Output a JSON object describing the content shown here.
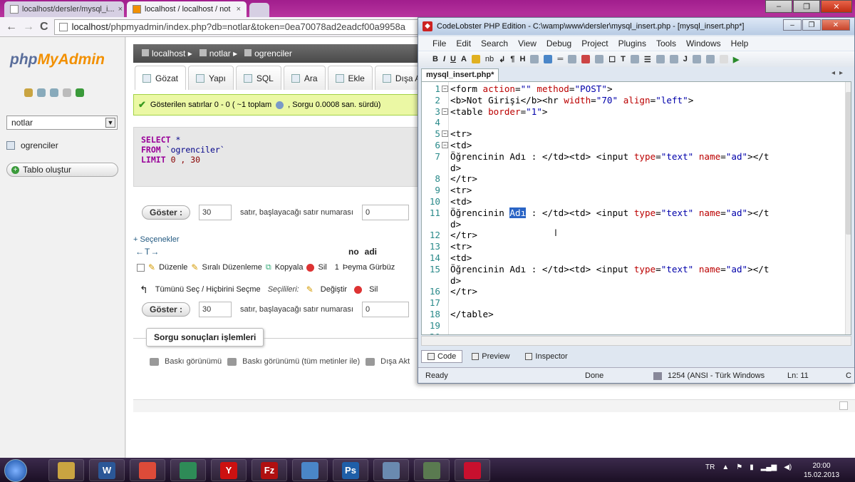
{
  "browser": {
    "tabs": [
      {
        "label": "localhost/dersler/mysql_i..."
      },
      {
        "label": "localhost / localhost / not"
      }
    ],
    "tab_close": "×",
    "url_host": "localhost",
    "url_rest": "/phpmyadmin/index.php?db=notlar&token=0ea70078ad2eadcf00a9958a",
    "back": "←",
    "forward": "→",
    "reload": "C"
  },
  "window_controls": {
    "min": "–",
    "max": "❐",
    "close": "✕"
  },
  "pma": {
    "logo_php": "php",
    "logo_myadmin": "MyAdmin",
    "db_select": "notlar",
    "table_item": "ogrenciler",
    "create_table": "Tablo oluştur",
    "breadcrumb": [
      "localhost",
      "notlar",
      "ogrenciler"
    ],
    "tabs": [
      "Gözat",
      "Yapı",
      "SQL",
      "Ara",
      "Ekle",
      "Dışa A"
    ],
    "success": "Gösterilen satırlar 0 - 0 ( ~1 toplam",
    "success_tail": ", Sorgu 0.0008 san. sürdü)",
    "sql": {
      "select_kw": "SELECT",
      "select_val": "*",
      "from_kw": "FROM",
      "from_val": "`ogrenciler`",
      "limit_kw": "LIMIT",
      "limit_val": "0 , 30"
    },
    "show_button": "Göster :",
    "rows_value": "30",
    "rows_label": "satır, başlayacağı satır numarası",
    "start_value": "0",
    "options_link": "+ Seçenekler",
    "resize_arrows": "←T→",
    "columns": [
      "no",
      "adi"
    ],
    "row": {
      "edit": "Düzenle",
      "inline_edit": "Sıralı Düzenleme",
      "copy": "Kopyala",
      "delete": "Sil",
      "no": "1",
      "adi": "Þeyma Gürbüz"
    },
    "check_all": "Tümünü Seç / Hiçbirini Seçme",
    "selected": "Seçilileri:",
    "change": "Değiştir",
    "delete_sel": "Sil",
    "ops_legend": "Sorgu sonuçları işlemleri",
    "ops": [
      "Baskı görünümü",
      "Baskı görünümü (tüm metinler ile)",
      "Dışa Akt"
    ]
  },
  "codelobster": {
    "title": "CodeLobster PHP Edition - C:\\wamp\\www\\dersler\\mysql_insert.php - [mysql_insert.php*]",
    "menu": [
      "File",
      "Edit",
      "Search",
      "View",
      "Debug",
      "Project",
      "Plugins",
      "Tools",
      "Windows",
      "Help"
    ],
    "file_tab": "mysql_insert.php*",
    "mode_tabs": [
      "Code",
      "Preview",
      "Inspector"
    ],
    "status": {
      "state": "Ready",
      "done": "Done",
      "encoding": "1254 (ANSI - Türk Windows",
      "line": "Ln: 11",
      "col": "C"
    }
  },
  "code": [
    {
      "n": "1",
      "parts": [
        [
          "tg",
          "<form "
        ],
        [
          "at",
          "action"
        ],
        [
          "tg",
          "="
        ],
        [
          "av",
          "\"\""
        ],
        [
          "tg",
          " "
        ],
        [
          "at",
          "method"
        ],
        [
          "tg",
          "="
        ],
        [
          "av",
          "\"POST\""
        ],
        [
          "tg",
          ">"
        ]
      ]
    },
    {
      "n": "2",
      "parts": [
        [
          "tg",
          "<b>Not Girişi</b><hr "
        ],
        [
          "at",
          "width"
        ],
        [
          "tg",
          "="
        ],
        [
          "av",
          "\"70\""
        ],
        [
          "tg",
          " "
        ],
        [
          "at",
          "align"
        ],
        [
          "tg",
          "="
        ],
        [
          "av",
          "\"left\""
        ],
        [
          "tg",
          ">"
        ]
      ]
    },
    {
      "n": "3",
      "parts": [
        [
          "tg",
          "<table "
        ],
        [
          "at",
          "border"
        ],
        [
          "tg",
          "="
        ],
        [
          "av",
          "\"1\""
        ],
        [
          "tg",
          ">"
        ]
      ]
    },
    {
      "n": "4",
      "parts": []
    },
    {
      "n": "5",
      "parts": [
        [
          "tg",
          "<tr>"
        ]
      ]
    },
    {
      "n": "6",
      "parts": [
        [
          "tg",
          "<td>"
        ]
      ]
    },
    {
      "n": "7",
      "parts": [
        [
          "cw",
          "Öğrencinin Adı : "
        ],
        [
          "tg",
          "</td><td> <input "
        ],
        [
          "at",
          "type"
        ],
        [
          "tg",
          "="
        ],
        [
          "av",
          "\"text\""
        ],
        [
          "tg",
          " "
        ],
        [
          "at",
          "name"
        ],
        [
          "tg",
          "="
        ],
        [
          "av",
          "\"ad\""
        ],
        [
          "tg",
          "></t"
        ]
      ]
    },
    {
      "n": "",
      "parts": [
        [
          "tg",
          "d>"
        ]
      ]
    },
    {
      "n": "8",
      "parts": [
        [
          "tg",
          "</tr>"
        ]
      ]
    },
    {
      "n": "9",
      "parts": [
        [
          "tg",
          "<tr>"
        ]
      ]
    },
    {
      "n": "10",
      "parts": [
        [
          "tg",
          "<td>"
        ]
      ]
    },
    {
      "n": "11",
      "parts": [
        [
          "cw",
          "Öğrencinin "
        ],
        [
          "sel",
          "Adı"
        ],
        [
          "cw",
          " : "
        ],
        [
          "tg",
          "</td><td> <input "
        ],
        [
          "at",
          "type"
        ],
        [
          "tg",
          "="
        ],
        [
          "av",
          "\"text\""
        ],
        [
          "tg",
          " "
        ],
        [
          "at",
          "name"
        ],
        [
          "tg",
          "="
        ],
        [
          "av",
          "\"ad\""
        ],
        [
          "tg",
          "></t"
        ]
      ]
    },
    {
      "n": "",
      "parts": [
        [
          "tg",
          "d>"
        ]
      ]
    },
    {
      "n": "12",
      "parts": [
        [
          "tg",
          "</tr>"
        ]
      ]
    },
    {
      "n": "13",
      "parts": [
        [
          "tg",
          "<tr>"
        ]
      ]
    },
    {
      "n": "14",
      "parts": [
        [
          "tg",
          "<td>"
        ]
      ]
    },
    {
      "n": "15",
      "parts": [
        [
          "cw",
          "Öğrencinin Adı : "
        ],
        [
          "tg",
          "</td><td> <input "
        ],
        [
          "at",
          "type"
        ],
        [
          "tg",
          "="
        ],
        [
          "av",
          "\"text\""
        ],
        [
          "tg",
          " "
        ],
        [
          "at",
          "name"
        ],
        [
          "tg",
          "="
        ],
        [
          "av",
          "\"ad\""
        ],
        [
          "tg",
          "></t"
        ]
      ]
    },
    {
      "n": "",
      "parts": [
        [
          "tg",
          "d>"
        ]
      ]
    },
    {
      "n": "16",
      "parts": [
        [
          "tg",
          "</tr>"
        ]
      ]
    },
    {
      "n": "17",
      "parts": []
    },
    {
      "n": "18",
      "parts": [
        [
          "tg",
          "</table>"
        ]
      ]
    },
    {
      "n": "19",
      "parts": []
    },
    {
      "n": "20",
      "parts": []
    }
  ],
  "folds": [
    "1",
    "3",
    "5",
    "6"
  ],
  "taskbar": {
    "lang": "TR",
    "time": "20:00",
    "date": "15.02.2013",
    "apps": [
      {
        "label": "",
        "color": "#c9a441"
      },
      {
        "label": "W",
        "color": "#2b5797"
      },
      {
        "label": "",
        "color": "#dd4b39"
      },
      {
        "label": "",
        "color": "#2e8b57"
      },
      {
        "label": "Y",
        "color": "#cc1111"
      },
      {
        "label": "Fz",
        "color": "#b01010"
      },
      {
        "label": "",
        "color": "#4a86c8"
      },
      {
        "label": "Ps",
        "color": "#1f5fa8"
      },
      {
        "label": "",
        "color": "#6a8ab0"
      },
      {
        "label": "",
        "color": "#5a7a50"
      },
      {
        "label": "",
        "color": "#c8102e"
      }
    ]
  }
}
